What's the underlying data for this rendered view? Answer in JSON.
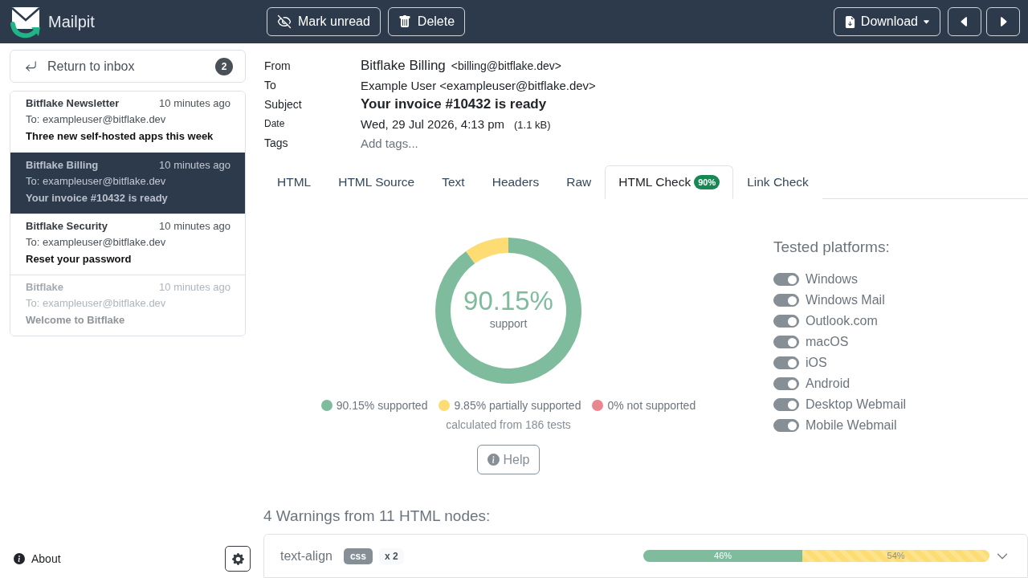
{
  "header": {
    "app_name": "Mailpit",
    "actions": [
      {
        "label": "Mark unread",
        "kind": "mark-unread"
      },
      {
        "label": "Delete",
        "kind": "delete"
      }
    ],
    "download": {
      "label": "Download"
    },
    "nav": [
      {
        "kind": "previous"
      },
      {
        "kind": "next"
      }
    ]
  },
  "sidebar": {
    "return_button": {
      "label": "Return to inbox",
      "badge": "2"
    },
    "messages": [
      {
        "from": "Bitflake Newsletter",
        "time": "10 minutes ago",
        "to": "To: exampleuser@bitflake.dev",
        "subject": "Three new self-hosted apps this week",
        "selected": false,
        "read": false
      },
      {
        "from": "Bitflake Billing",
        "time": "10 minutes ago",
        "to": "To: exampleuser@bitflake.dev",
        "subject": "Your invoice #10432 is ready",
        "selected": true,
        "read": false
      },
      {
        "from": "Bitflake Security",
        "time": "10 minutes ago",
        "to": "To: exampleuser@bitflake.dev",
        "subject": "Reset your password",
        "selected": false,
        "read": false
      },
      {
        "from": "Bitflake",
        "time": "10 minutes ago",
        "to": "To: exampleuser@bitflake.dev",
        "subject": "Welcome to Bitflake",
        "selected": false,
        "read": true
      }
    ],
    "about": "About"
  },
  "message": {
    "headers": [
      {
        "kind": "from",
        "label": "From",
        "name": "Bitflake Billing",
        "address": "<billing@bitflake.dev>"
      },
      {
        "kind": "to",
        "label": "To",
        "value": "Example User <exampleuser@bitflake.dev>"
      },
      {
        "kind": "subject",
        "label": "Subject",
        "value": "Your invoice #10432 is ready"
      },
      {
        "kind": "date",
        "label": "Date",
        "value": "Wed, 29 Jul 2026, 4:13 pm",
        "size": "(1.1 kB)"
      },
      {
        "kind": "tags",
        "label": "Tags",
        "placeholder": "Add tags..."
      }
    ]
  },
  "tabs": [
    {
      "label": "HTML",
      "selected": false
    },
    {
      "label": "HTML Source",
      "selected": false
    },
    {
      "label": "Text",
      "selected": false
    },
    {
      "label": "Headers",
      "selected": false
    },
    {
      "label": "Raw",
      "selected": false
    },
    {
      "label": "HTML Check",
      "selected": true,
      "badge": "90%"
    },
    {
      "label": "Link Check",
      "selected": false
    }
  ],
  "html_check": {
    "donut": {
      "value": "90.15%",
      "caption": "support",
      "chart_data": {
        "type": "donut",
        "values": [
          90.15,
          9.85,
          0
        ]
      }
    },
    "legend": [
      {
        "label": "90.15% supported",
        "color": "#7fbc9d"
      },
      {
        "label": "9.85% partially supported",
        "color": "#fcdc73"
      },
      {
        "label": "0% not supported",
        "color": "#e9868f"
      }
    ],
    "note": "calculated from 186 tests",
    "help_button": "Help",
    "platforms": {
      "title": "Tested platforms:",
      "items": [
        {
          "label": "Windows",
          "on": true
        },
        {
          "label": "Windows Mail",
          "on": true
        },
        {
          "label": "Outlook.com",
          "on": true
        },
        {
          "label": "macOS",
          "on": true
        },
        {
          "label": "iOS",
          "on": true
        },
        {
          "label": "Android",
          "on": true
        },
        {
          "label": "Desktop Webmail",
          "on": true
        },
        {
          "label": "Mobile Webmail",
          "on": true
        }
      ]
    },
    "warnings": {
      "title": "4 Warnings from 11 HTML nodes:",
      "items": [
        {
          "name": "text-align",
          "type": "css",
          "count": "x 2",
          "expanded": false,
          "segments": [
            {
              "kind": "supported",
              "label": "46%",
              "level": 0.46
            },
            {
              "kind": "partial",
              "label": "54%",
              "level": 0.54
            }
          ]
        }
      ]
    }
  }
}
